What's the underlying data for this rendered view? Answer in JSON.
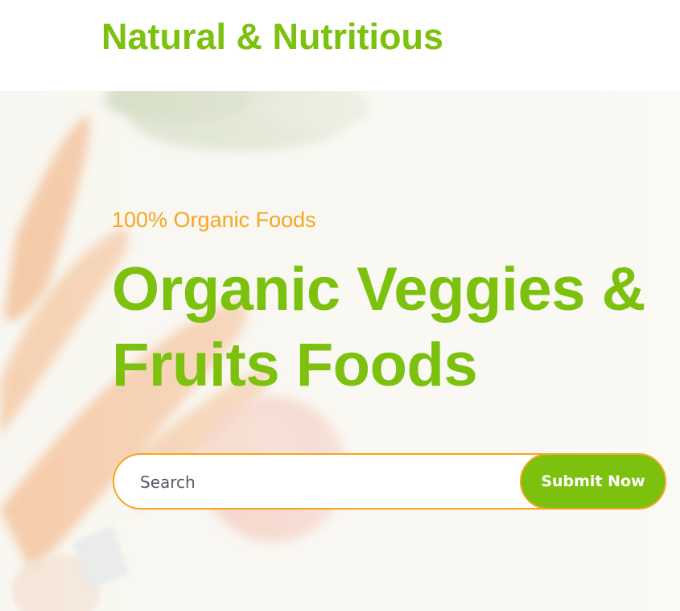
{
  "header": {
    "brand_title": "Natural & Nutritious"
  },
  "hero": {
    "tagline": "100% Organic Foods",
    "headline_line1": "Organic Veggies &",
    "headline_line2": "Fruits Foods"
  },
  "search": {
    "placeholder": "Search",
    "submit_label": "Submit Now"
  },
  "colors": {
    "brand_green": "#7bc10e",
    "accent_orange": "#f6a623",
    "hero_background": "#f8f7f1",
    "input_placeholder": "#555a66"
  },
  "hero_image": {
    "subject": "carrots, vegetables and fruits"
  }
}
